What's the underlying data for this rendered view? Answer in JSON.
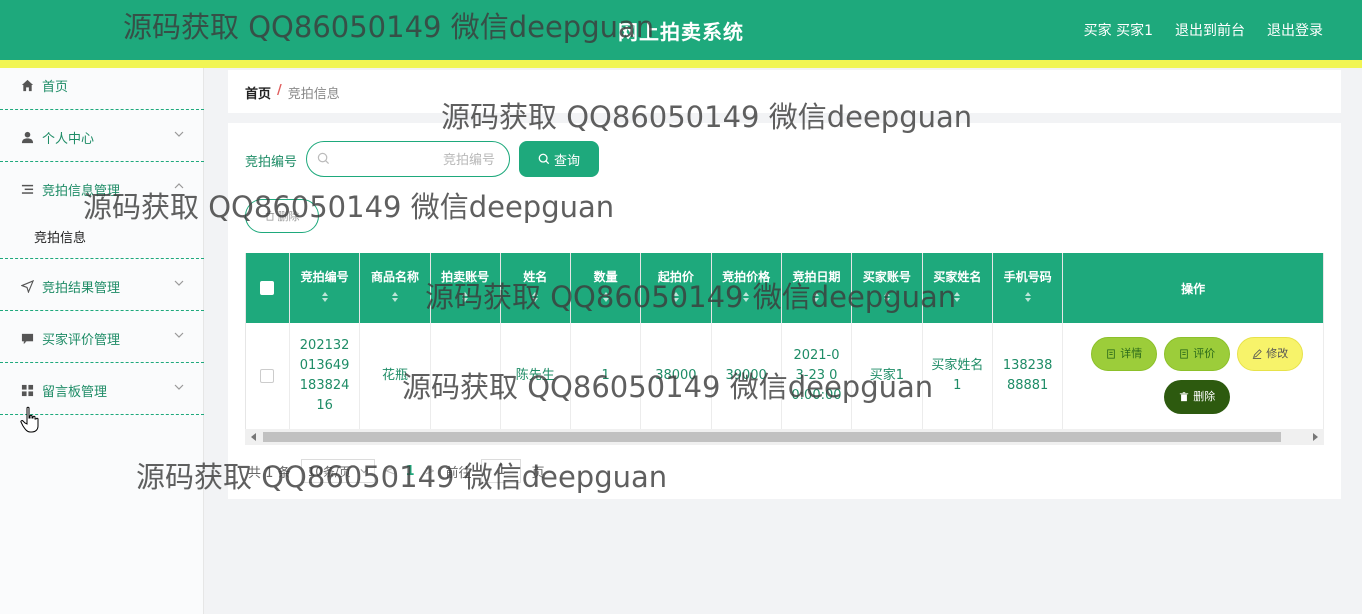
{
  "header": {
    "title": "网上拍卖系统",
    "user_label": "买家 买家1",
    "back_label": "退出到前台",
    "logout_label": "退出登录"
  },
  "sidebar": {
    "items": [
      {
        "label": "首页",
        "icon": "home-icon"
      },
      {
        "label": "个人中心",
        "icon": "user-icon"
      },
      {
        "label": "竞拍信息管理",
        "icon": "list-icon",
        "children": [
          "竞拍信息"
        ]
      },
      {
        "label": "竞拍结果管理",
        "icon": "send-icon"
      },
      {
        "label": "买家评价管理",
        "icon": "comment-icon"
      },
      {
        "label": "留言板管理",
        "icon": "grid-icon"
      }
    ]
  },
  "breadcrumb": {
    "home": "首页",
    "separator": "/",
    "current": "竞拍信息"
  },
  "search": {
    "label": "竞拍编号",
    "placeholder": "竞拍编号",
    "value": "",
    "query_label": "查询"
  },
  "toolbar": {
    "delete_label": "删除"
  },
  "table": {
    "headers": [
      "竞拍编号",
      "商品名称",
      "拍卖账号",
      "姓名",
      "数量",
      "起拍价",
      "竞拍价格",
      "竞拍日期",
      "买家账号",
      "买家姓名",
      "手机号码",
      "操作"
    ],
    "rows": [
      {
        "cells": [
          "20213201364918382416",
          "花瓶",
          "",
          "陈先生",
          "1",
          "38000",
          "39000",
          "2021-03-23 00:00:00",
          "买家1",
          "买家姓名1",
          "13823888881"
        ],
        "actions": {
          "detail": "详情",
          "rate": "评价",
          "edit": "修改",
          "delete": "删除"
        }
      }
    ]
  },
  "pagination": {
    "total_prefix": "共",
    "total_count": "1",
    "total_suffix": "条",
    "page_size": "10条/页",
    "prev": "<",
    "current_page": "1",
    "next": ">",
    "goto_prefix": "前往",
    "goto_value": "1",
    "goto_suffix": "页"
  },
  "watermark": {
    "text": "源码获取 QQ86050149 微信deepguan"
  },
  "colors": {
    "primary": "#1ea97c",
    "stripe": "#f1f555",
    "detail_btn": "#9ccd3a",
    "edit_btn": "#f7f36a",
    "delete_btn": "#2d5a0f"
  }
}
